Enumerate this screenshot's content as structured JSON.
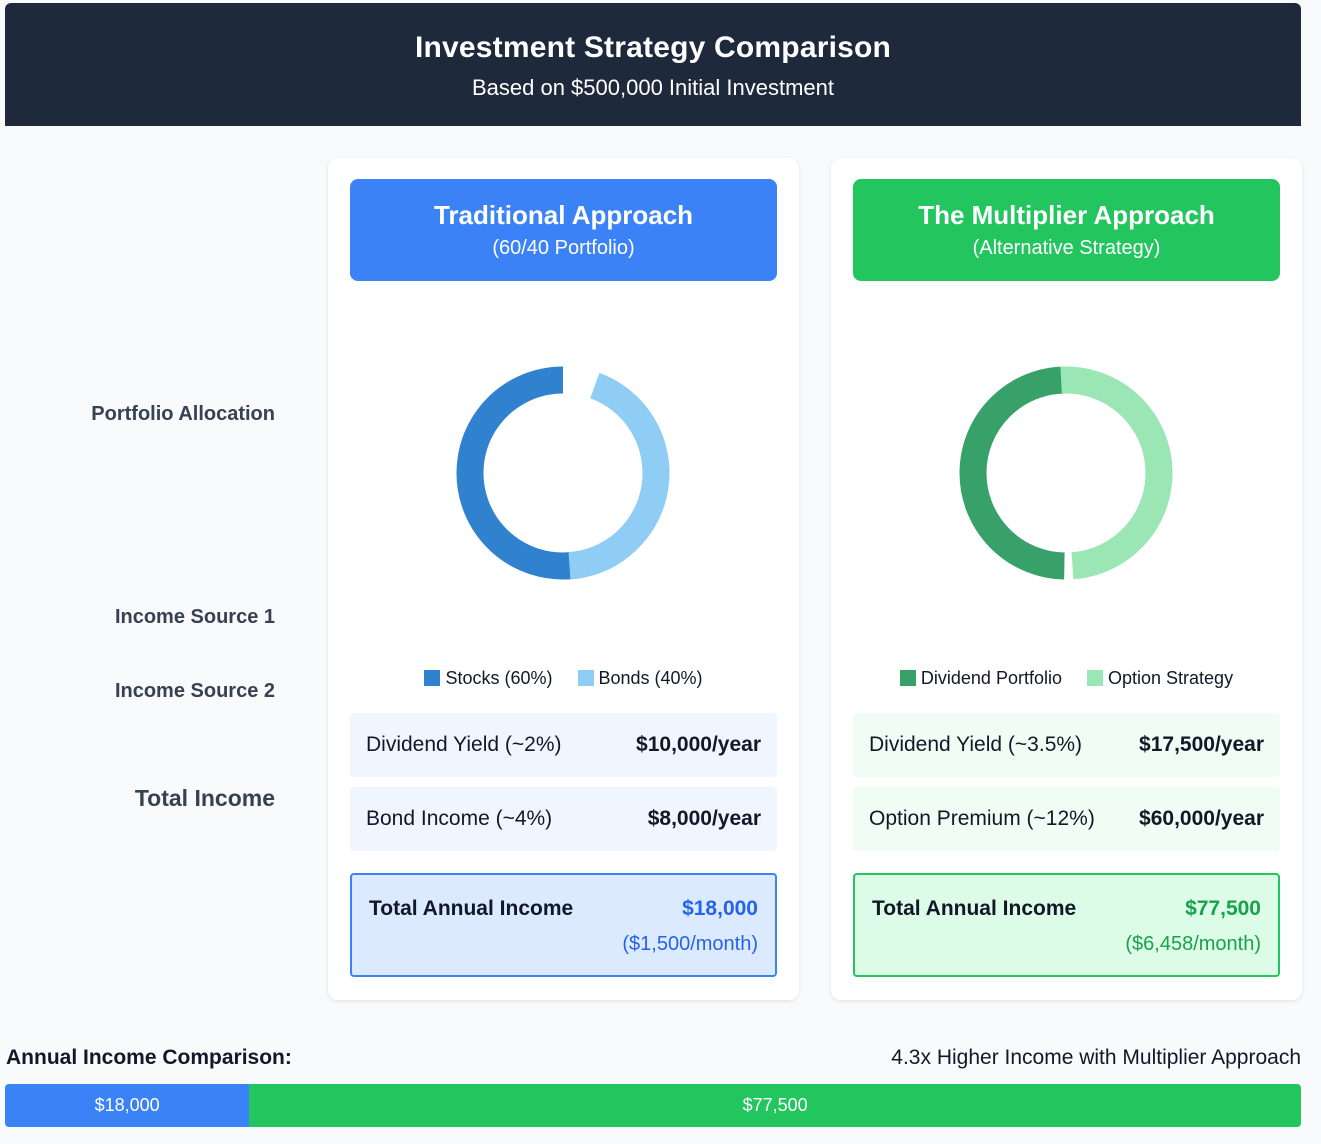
{
  "header": {
    "title": "Investment Strategy Comparison",
    "subtitle": "Based on $500,000 Initial Investment"
  },
  "row_labels": {
    "allocation": "Portfolio Allocation",
    "income1": "Income Source 1",
    "income2": "Income Source 2",
    "total": "Total Income"
  },
  "colors": {
    "header_bg": "#1e293b",
    "traditional": "#3b82f6",
    "multiplier": "#22c55e",
    "stocks": "#3182ce",
    "bonds": "#90cdf4",
    "dividend_portfolio": "#38a169",
    "option_strategy": "#9ae6b4"
  },
  "traditional": {
    "title": "Traditional Approach",
    "subtitle": "(60/40 Portfolio)",
    "allocation": [
      {
        "label": "Stocks (60%)",
        "percent": 60,
        "color": "#3182ce"
      },
      {
        "label": "Bonds (40%)",
        "percent": 40,
        "color": "#90cdf4"
      }
    ],
    "income1": {
      "label": "Dividend Yield (~2%)",
      "value": "$10,000/year"
    },
    "income2": {
      "label": "Bond Income (~4%)",
      "value": "$8,000/year"
    },
    "total": {
      "label": "Total Annual Income",
      "value": "$18,000",
      "monthly": "($1,500/month)"
    }
  },
  "multiplier": {
    "title": "The Multiplier Approach",
    "subtitle": "(Alternative Strategy)",
    "allocation": [
      {
        "label": "Dividend Portfolio",
        "percent": 50,
        "color": "#38a169"
      },
      {
        "label": "Option Strategy",
        "percent": 50,
        "color": "#9ae6b4"
      }
    ],
    "income1": {
      "label": "Dividend Yield (~3.5%)",
      "value": "$17,500/year"
    },
    "income2": {
      "label": "Option Premium (~12%)",
      "value": "$60,000/year"
    },
    "total": {
      "label": "Total Annual Income",
      "value": "$77,500",
      "monthly": "($6,458/month)"
    }
  },
  "comparison": {
    "label": "Annual Income Comparison:",
    "note": "4.3x Higher Income with Multiplier Approach",
    "bars": [
      {
        "label": "$18,000",
        "value": 18000,
        "color": "#3b82f6"
      },
      {
        "label": "$77,500",
        "value": 77500,
        "color": "#22c55e"
      }
    ]
  }
}
